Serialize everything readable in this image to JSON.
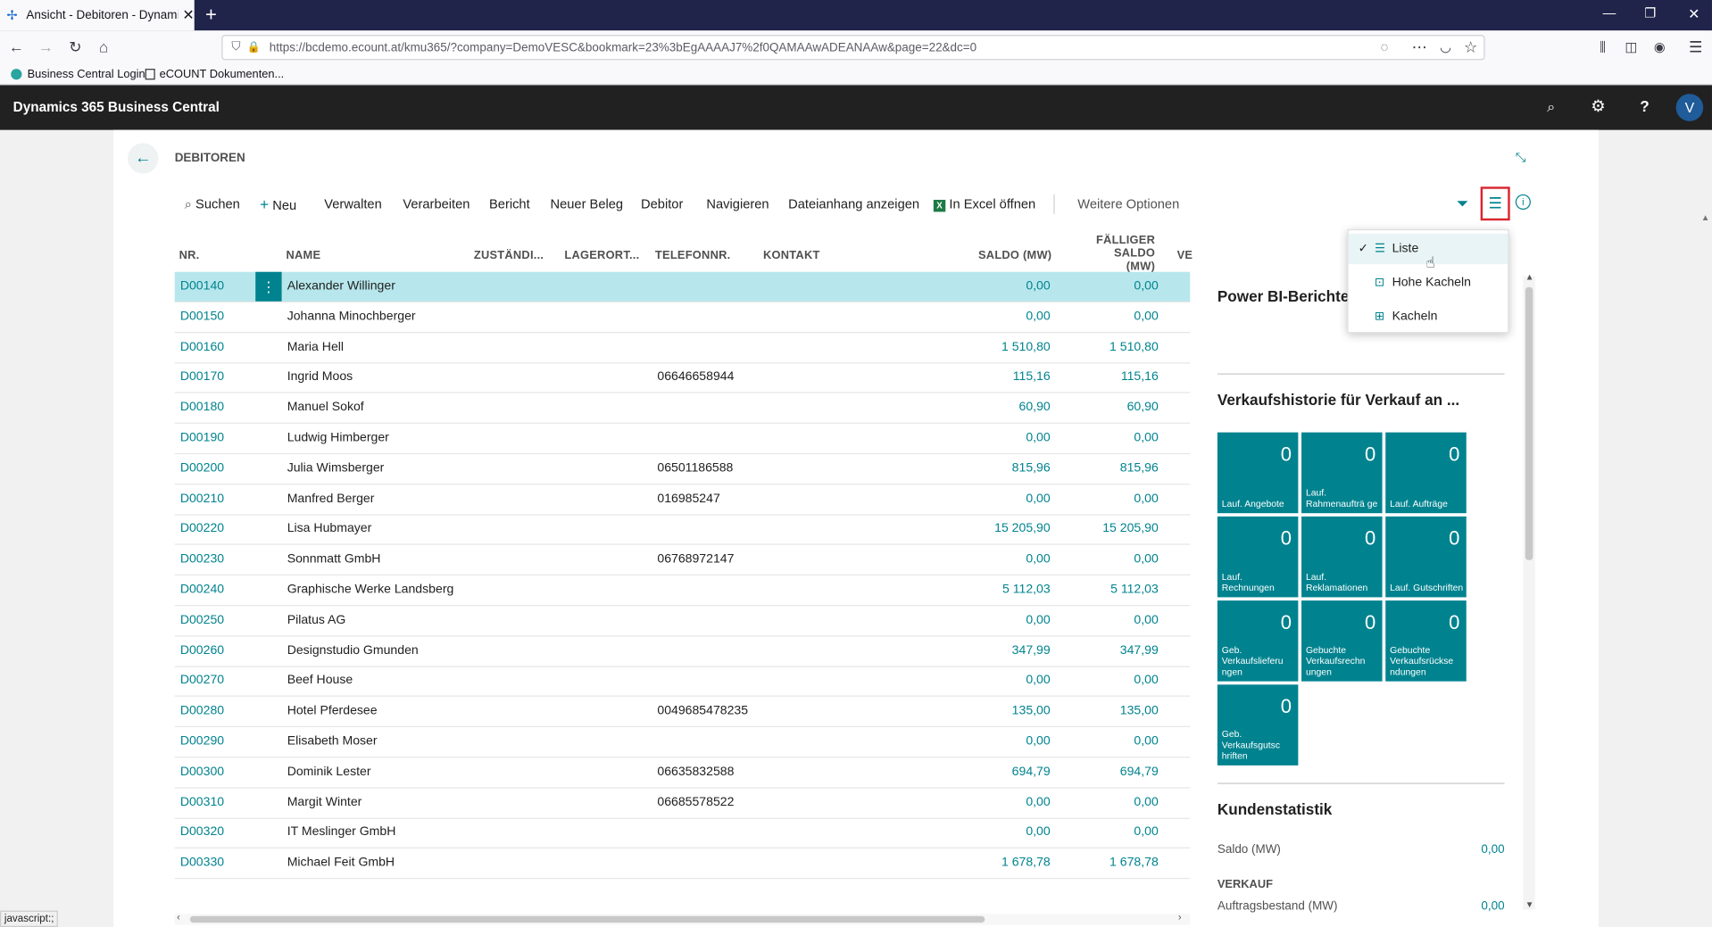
{
  "browser": {
    "tab_title": "Ansicht - Debitoren - Dynamic",
    "new_tab": "+",
    "url": "https://bcdemo.ecount.at/kmu365/?company=DemoVESC&bookmark=23%3bEgAAAAJ7%2f0QAMAAwADEANAAw&page=22&dc=0",
    "url_host_part": "bcdemo.ecount.at",
    "bookmarks": [
      "Business Central Login",
      "eCOUNT Dokumenten..."
    ],
    "status_text": "javascript:;"
  },
  "app": {
    "title": "Dynamics 365 Business Central",
    "avatar_letter": "V"
  },
  "page": {
    "title": "DEBITOREN",
    "actions": [
      "Suchen",
      "Neu",
      "Verwalten",
      "Verarbeiten",
      "Bericht",
      "Neuer Beleg",
      "Debitor",
      "Navigieren",
      "Dateianhang anzeigen",
      "In Excel öffnen",
      "Weitere Optionen"
    ]
  },
  "table": {
    "headers": {
      "nr": "NR.",
      "name": "NAME",
      "zust": "ZUSTÄNDI...",
      "lager": "LAGERORT...",
      "tel": "TELEFONNR.",
      "kontakt": "KONTAKT",
      "saldo": "SALDO (MW)",
      "faellig_1": "FÄLLIGER",
      "faellig_2": "SALDO (MW)",
      "ve": "VE"
    },
    "rows": [
      {
        "nr": "D00140",
        "name": "Alexander Willinger",
        "tel": "",
        "saldo": "0,00",
        "faellig": "0,00"
      },
      {
        "nr": "D00150",
        "name": "Johanna Minochberger",
        "tel": "",
        "saldo": "0,00",
        "faellig": "0,00"
      },
      {
        "nr": "D00160",
        "name": "Maria Hell",
        "tel": "",
        "saldo": "1 510,80",
        "faellig": "1 510,80"
      },
      {
        "nr": "D00170",
        "name": "Ingrid Moos",
        "tel": "06646658944",
        "saldo": "115,16",
        "faellig": "115,16"
      },
      {
        "nr": "D00180",
        "name": "Manuel Sokof",
        "tel": "",
        "saldo": "60,90",
        "faellig": "60,90"
      },
      {
        "nr": "D00190",
        "name": "Ludwig Himberger",
        "tel": "",
        "saldo": "0,00",
        "faellig": "0,00"
      },
      {
        "nr": "D00200",
        "name": "Julia Wimsberger",
        "tel": "06501186588",
        "saldo": "815,96",
        "faellig": "815,96"
      },
      {
        "nr": "D00210",
        "name": "Manfred Berger",
        "tel": "016985247",
        "saldo": "0,00",
        "faellig": "0,00"
      },
      {
        "nr": "D00220",
        "name": "Lisa Hubmayer",
        "tel": "",
        "saldo": "15 205,90",
        "faellig": "15 205,90"
      },
      {
        "nr": "D00230",
        "name": "Sonnmatt GmbH",
        "tel": "06768972147",
        "saldo": "0,00",
        "faellig": "0,00"
      },
      {
        "nr": "D00240",
        "name": "Graphische Werke Landsberg",
        "tel": "",
        "saldo": "5 112,03",
        "faellig": "5 112,03"
      },
      {
        "nr": "D00250",
        "name": "Pilatus AG",
        "tel": "",
        "saldo": "0,00",
        "faellig": "0,00"
      },
      {
        "nr": "D00260",
        "name": "Designstudio Gmunden",
        "tel": "",
        "saldo": "347,99",
        "faellig": "347,99"
      },
      {
        "nr": "D00270",
        "name": "Beef House",
        "tel": "",
        "saldo": "0,00",
        "faellig": "0,00"
      },
      {
        "nr": "D00280",
        "name": "Hotel Pferdesee",
        "tel": "0049685478235",
        "saldo": "135,00",
        "faellig": "135,00"
      },
      {
        "nr": "D00290",
        "name": "Elisabeth Moser",
        "tel": "",
        "saldo": "0,00",
        "faellig": "0,00"
      },
      {
        "nr": "D00300",
        "name": "Dominik Lester",
        "tel": "06635832588",
        "saldo": "694,79",
        "faellig": "694,79"
      },
      {
        "nr": "D00310",
        "name": "Margit Winter",
        "tel": "06685578522",
        "saldo": "0,00",
        "faellig": "0,00"
      },
      {
        "nr": "D00320",
        "name": "IT Meslinger GmbH",
        "tel": "",
        "saldo": "0,00",
        "faellig": "0,00"
      },
      {
        "nr": "D00330",
        "name": "Michael Feit GmbH",
        "tel": "",
        "saldo": "1 678,78",
        "faellig": "1 678,78"
      }
    ]
  },
  "factbox": {
    "powerbi_title": "Power BI-Berichte",
    "history_title": "Verkaufshistorie für Verkauf an ...",
    "tiles": [
      {
        "count": "0",
        "label": "Lauf. Angebote"
      },
      {
        "count": "0",
        "label": "Lauf. Rahmenaufträ ge"
      },
      {
        "count": "0",
        "label": "Lauf. Aufträge"
      },
      {
        "count": "0",
        "label": "Lauf. Rechnungen"
      },
      {
        "count": "0",
        "label": "Lauf. Reklamationen"
      },
      {
        "count": "0",
        "label": "Lauf. Gutschriften"
      },
      {
        "count": "0",
        "label": "Geb. Verkaufslieferu ngen"
      },
      {
        "count": "0",
        "label": "Gebuchte Verkaufsrechn ungen"
      },
      {
        "count": "0",
        "label": "Gebuchte Verkaufsrückse ndungen"
      },
      {
        "count": "0",
        "label": "Geb. Verkaufsgutsc hriften"
      }
    ],
    "stats_title": "Kundenstatistik",
    "saldo_label": "Saldo (MW)",
    "saldo_value": "0,00",
    "verkauf_label": "VERKAUF",
    "auftrag_label": "Auftragsbestand (MW)",
    "auftrag_value": "0,00"
  },
  "view_menu": {
    "items": [
      "Liste",
      "Hohe Kacheln",
      "Kacheln"
    ],
    "checked": "Liste"
  },
  "colors": {
    "accent": "#00838f",
    "selected_row": "#b7e7ec",
    "header_bg": "#212121",
    "browser_titlebar": "#20234a"
  }
}
